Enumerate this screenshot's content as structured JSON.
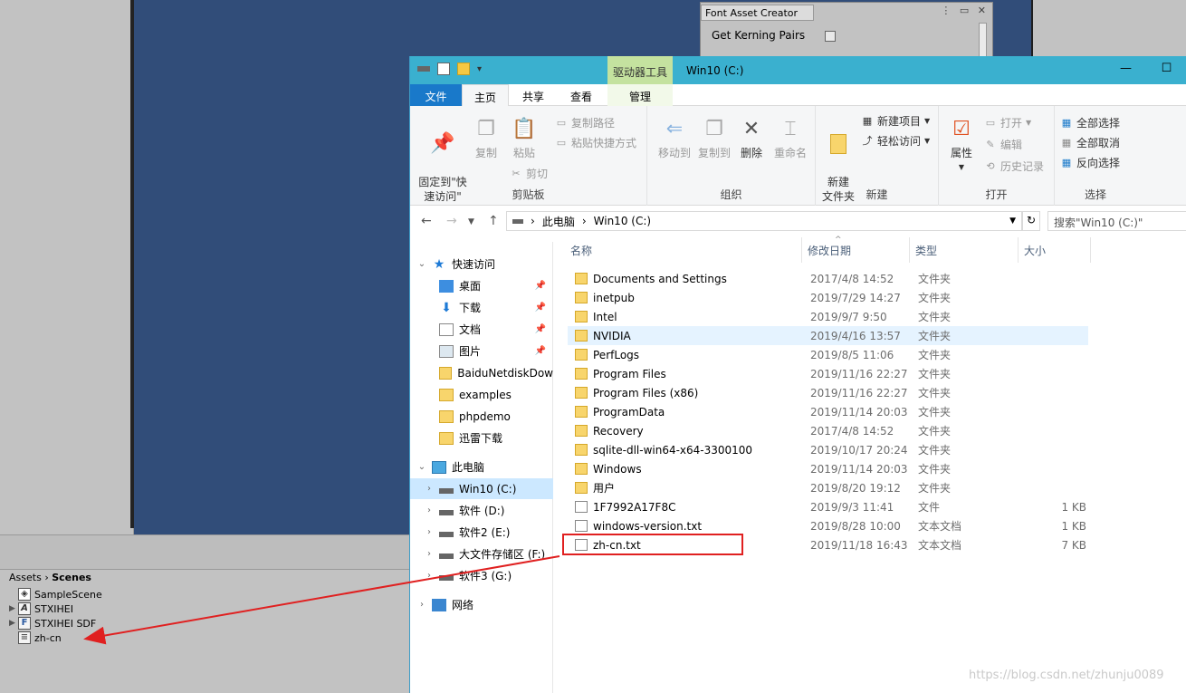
{
  "unity": {
    "font_asset_creator": {
      "tab": "Font Asset Creator",
      "label": "Get Kerning Pairs"
    },
    "project": {
      "breadcrumb_root": "Assets",
      "breadcrumb_sep": "›",
      "breadcrumb_current": "Scenes",
      "assets": [
        {
          "name": "SampleScene",
          "icon": "unity-scene-icon",
          "expandable": false
        },
        {
          "name": "STXIHEI",
          "icon": "font-icon",
          "expandable": true
        },
        {
          "name": "STXIHEI SDF",
          "icon": "font-asset-icon",
          "expandable": true
        },
        {
          "name": "zh-cn",
          "icon": "text-asset-icon",
          "expandable": false
        }
      ]
    }
  },
  "explorer": {
    "title": "Win10 (C:)",
    "context_tab": "驱动器工具",
    "tabs": [
      "文件",
      "主页",
      "共享",
      "查看",
      "管理"
    ],
    "ribbon": {
      "clipboard": {
        "label": "剪贴板",
        "pin": "固定到\"快\n速访问\"",
        "copy": "复制",
        "paste": "粘贴",
        "copy_path": "复制路径",
        "paste_shortcut": "粘贴快捷方式",
        "cut": "剪切"
      },
      "organize": {
        "label": "组织",
        "move_to": "移动到",
        "copy_to": "复制到",
        "delete": "删除",
        "rename": "重命名"
      },
      "new": {
        "label": "新建",
        "new_folder": "新建\n文件夹",
        "new_item": "新建项目",
        "easy_access": "轻松访问"
      },
      "open": {
        "label": "打开",
        "properties": "属性",
        "open": "打开",
        "edit": "编辑",
        "history": "历史记录"
      },
      "select": {
        "label": "选择",
        "select_all": "全部选择",
        "select_none": "全部取消",
        "invert": "反向选择"
      }
    },
    "address": {
      "segments": [
        "此电脑",
        "Win10 (C:)"
      ],
      "search_placeholder": "搜索\"Win10 (C:)\""
    },
    "nav": {
      "quick_access": "快速访问",
      "quick_items": [
        {
          "label": "桌面",
          "icon": "desktop",
          "pinned": true
        },
        {
          "label": "下载",
          "icon": "download",
          "pinned": true
        },
        {
          "label": "文档",
          "icon": "doc",
          "pinned": true
        },
        {
          "label": "图片",
          "icon": "pictures",
          "pinned": true
        },
        {
          "label": "BaiduNetdiskDow",
          "icon": "folder",
          "pinned": false
        },
        {
          "label": "examples",
          "icon": "folder",
          "pinned": false
        },
        {
          "label": "phpdemo",
          "icon": "folder",
          "pinned": false
        },
        {
          "label": "迅雷下载",
          "icon": "folder",
          "pinned": false
        }
      ],
      "this_pc": "此电脑",
      "drives": [
        "Win10 (C:)",
        "软件 (D:)",
        "软件2 (E:)",
        "大文件存储区 (F:)",
        "软件3 (G:)"
      ],
      "network": "网络"
    },
    "columns": {
      "name": "名称",
      "date": "修改日期",
      "type": "类型",
      "size": "大小"
    },
    "files": [
      {
        "name": "Documents and Settings",
        "date": "2017/4/8 14:52",
        "type": "文件夹",
        "size": "",
        "kind": "folder"
      },
      {
        "name": "inetpub",
        "date": "2019/7/29 14:27",
        "type": "文件夹",
        "size": "",
        "kind": "folder"
      },
      {
        "name": "Intel",
        "date": "2019/9/7 9:50",
        "type": "文件夹",
        "size": "",
        "kind": "folder"
      },
      {
        "name": "NVIDIA",
        "date": "2019/4/16 13:57",
        "type": "文件夹",
        "size": "",
        "kind": "folder"
      },
      {
        "name": "PerfLogs",
        "date": "2019/8/5 11:06",
        "type": "文件夹",
        "size": "",
        "kind": "folder"
      },
      {
        "name": "Program Files",
        "date": "2019/11/16 22:27",
        "type": "文件夹",
        "size": "",
        "kind": "folder"
      },
      {
        "name": "Program Files (x86)",
        "date": "2019/11/16 22:27",
        "type": "文件夹",
        "size": "",
        "kind": "folder"
      },
      {
        "name": "ProgramData",
        "date": "2019/11/14 20:03",
        "type": "文件夹",
        "size": "",
        "kind": "folder"
      },
      {
        "name": "Recovery",
        "date": "2017/4/8 14:52",
        "type": "文件夹",
        "size": "",
        "kind": "folder"
      },
      {
        "name": "sqlite-dll-win64-x64-3300100",
        "date": "2019/10/17 20:24",
        "type": "文件夹",
        "size": "",
        "kind": "folder"
      },
      {
        "name": "Windows",
        "date": "2019/11/14 20:03",
        "type": "文件夹",
        "size": "",
        "kind": "folder"
      },
      {
        "name": "用户",
        "date": "2019/8/20 19:12",
        "type": "文件夹",
        "size": "",
        "kind": "folder"
      },
      {
        "name": "1F7992A17F8C",
        "date": "2019/9/3 11:41",
        "type": "文件",
        "size": "1 KB",
        "kind": "file"
      },
      {
        "name": "windows-version.txt",
        "date": "2019/8/28 10:00",
        "type": "文本文档",
        "size": "1 KB",
        "kind": "file"
      },
      {
        "name": "zh-cn.txt",
        "date": "2019/11/18 16:43",
        "type": "文本文档",
        "size": "7 KB",
        "kind": "file"
      }
    ]
  },
  "watermark": "https://blog.csdn.net/zhunju0089",
  "colors": {
    "highlight": "#e02020",
    "title_bar": "#3ab0cf",
    "scene": "#314d79"
  }
}
